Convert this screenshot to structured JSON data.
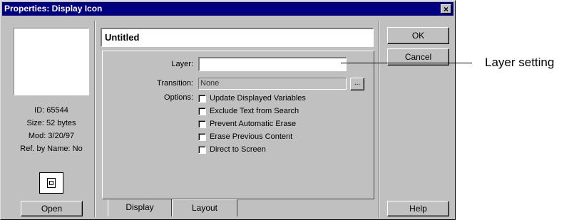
{
  "window": {
    "title": "Properties: Display Icon",
    "close_glyph": "×"
  },
  "icon_info": {
    "id_line": "ID: 65544",
    "size_line": "Size: 52 bytes",
    "mod_line": "Mod: 3/20/97",
    "ref_line": "Ref. by Name: No",
    "icon_name": "display-icon"
  },
  "buttons": {
    "open": "Open",
    "ok": "OK",
    "cancel": "Cancel",
    "help": "Help",
    "browse": "..."
  },
  "name_field": {
    "value": "Untitled"
  },
  "fields": {
    "layer_label": "Layer:",
    "layer_value": "",
    "transition_label": "Transition:",
    "transition_value": "None",
    "options_label": "Options:"
  },
  "options": [
    {
      "label": "Update Displayed Variables",
      "checked": false
    },
    {
      "label": "Exclude Text from Search",
      "checked": false
    },
    {
      "label": "Prevent Automatic Erase",
      "checked": false
    },
    {
      "label": "Erase Previous Content",
      "checked": false
    },
    {
      "label": "Direct to Screen",
      "checked": false
    }
  ],
  "tabs": [
    {
      "label": "Display",
      "active": true
    },
    {
      "label": "Layout",
      "active": false
    }
  ],
  "callout": {
    "text": "Layer setting"
  },
  "colors": {
    "face": "#c0c0c0",
    "titlebar": "#000080"
  }
}
